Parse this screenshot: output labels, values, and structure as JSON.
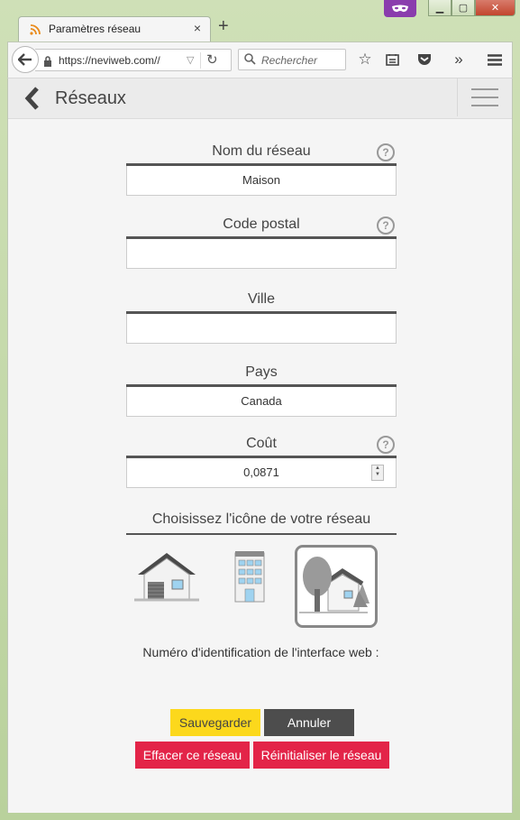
{
  "browser": {
    "tab_title": "Paramètres réseau",
    "tab_close": "×",
    "new_tab": "+",
    "window_controls": {
      "minimize": "▁",
      "maximize": "▢",
      "close": "✕"
    },
    "url": "https://neviweb.com//",
    "url_host_bold": "neviweb",
    "search_placeholder": "Rechercher",
    "toolbar_icons": [
      "star-icon",
      "reader-icon",
      "pocket-icon",
      "overflow-icon",
      "menu-icon"
    ]
  },
  "app": {
    "header_title": "Réseaux",
    "fields": [
      {
        "label": "Nom du réseau",
        "value": "Maison",
        "help": true
      },
      {
        "label": "Code postal",
        "value": "",
        "help": true
      },
      {
        "label": "Ville",
        "value": "",
        "help": false
      },
      {
        "label": "Pays",
        "value": "Canada",
        "help": false
      },
      {
        "label": "Coût",
        "value": "0,0871",
        "help": true
      }
    ],
    "help_glyph": "?",
    "icon_section_label": "Choisissez l'icône de votre réseau",
    "icon_options": [
      "house-icon",
      "building-icon",
      "cottage-tree-icon"
    ],
    "selected_icon": "cottage-tree-icon",
    "web_interface_label": "Numéro d'identification de l'interface web :",
    "buttons": {
      "save": "Sauvegarder",
      "cancel": "Annuler",
      "delete": "Effacer ce réseau",
      "reset": "Réinitialiser le réseau"
    },
    "colors": {
      "save": "#fcd81c",
      "cancel": "#4d4d4d",
      "danger": "#e32448"
    }
  }
}
